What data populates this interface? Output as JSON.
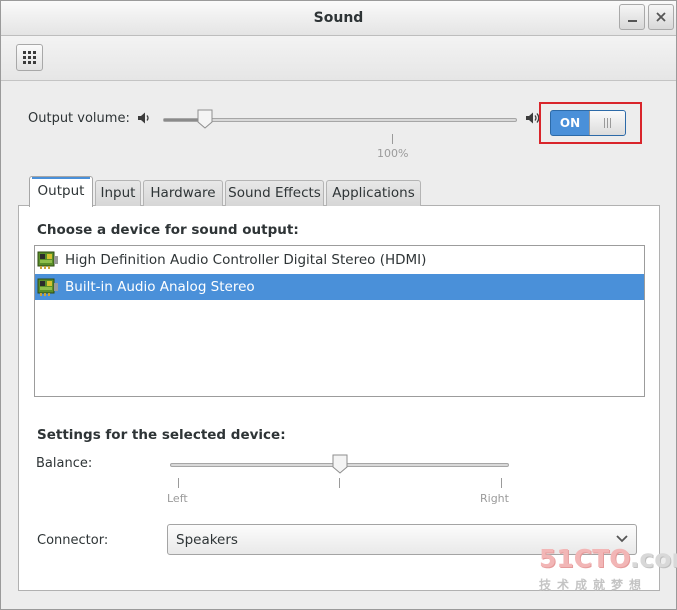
{
  "window": {
    "title": "Sound"
  },
  "output_volume": {
    "label": "Output volume:",
    "value_percent": 12,
    "tick_label": "100%",
    "switch_label": "ON",
    "switch_state": "on"
  },
  "tabs": [
    {
      "label": "Output",
      "active": true
    },
    {
      "label": "Input",
      "active": false
    },
    {
      "label": "Hardware",
      "active": false
    },
    {
      "label": "Sound Effects",
      "active": false
    },
    {
      "label": "Applications",
      "active": false
    }
  ],
  "output_panel": {
    "choose_heading": "Choose a device for sound output:",
    "devices": [
      {
        "label": "High Definition Audio Controller Digital Stereo (HDMI)",
        "selected": false,
        "icon": "audio-card-icon"
      },
      {
        "label": "Built-in Audio Analog Stereo",
        "selected": true,
        "icon": "audio-card-icon"
      }
    ],
    "settings_heading": "Settings for the selected device:",
    "balance": {
      "label": "Balance:",
      "value": 0.5,
      "left_label": "Left",
      "right_label": "Right"
    },
    "connector": {
      "label": "Connector:",
      "value": "Speakers"
    }
  },
  "watermark": {
    "brand_prefix": "51CTO",
    "brand_suffix": ".com",
    "tagline": "技术成就梦想"
  },
  "colors": {
    "selection": "#4a90d9",
    "highlight_box": "#d9252b",
    "switch_on": "#4a90d9"
  }
}
